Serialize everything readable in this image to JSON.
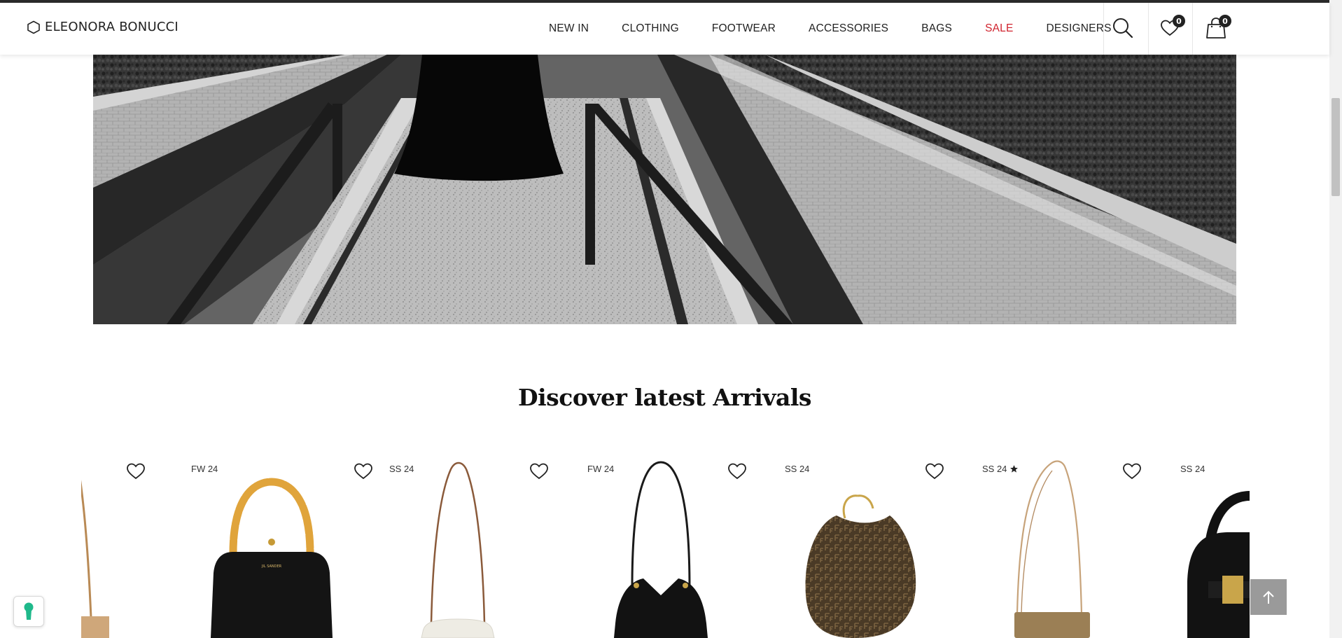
{
  "brand": {
    "name": "ELEONORA BONUCCI"
  },
  "nav": {
    "items": [
      {
        "label": "NEW IN"
      },
      {
        "label": "CLOTHING"
      },
      {
        "label": "FOOTWEAR"
      },
      {
        "label": "ACCESSORIES"
      },
      {
        "label": "BAGS"
      },
      {
        "label": "SALE"
      },
      {
        "label": "DESIGNERS"
      }
    ],
    "sale_color": "#d0232e"
  },
  "header_icons": {
    "search": "search-icon",
    "wishlist": {
      "icon": "heart-icon",
      "count": "0"
    },
    "cart": {
      "icon": "shopping-bag-icon",
      "count": "0"
    }
  },
  "hero": {
    "image": "black-and-white photo of a figure in a long black dress on a concrete walkway"
  },
  "section": {
    "title": "Discover latest Arrivals"
  },
  "products": [
    {
      "season": "",
      "image": "beige crossbody strap bag (partially visible)"
    },
    {
      "season": "FW 24",
      "image": "black leather handbag with bamboo handle"
    },
    {
      "season": "SS 24",
      "image": "white shoulder bag with long leather strap"
    },
    {
      "season": "FW 24",
      "image": "black leather hobo shoulder bag"
    },
    {
      "season": "SS 24",
      "image": "brown monogram croissant bag with gold chain"
    },
    {
      "season": "SS 24",
      "featured": true,
      "image": "tan crossbody bag with thin strap"
    },
    {
      "season": "SS 24",
      "image": "black top-handle bag with gold buckle (partially visible)"
    }
  ],
  "controls": {
    "back_to_top": "arrow-up-icon",
    "accessibility": "keyhole-icon"
  },
  "colors": {
    "text": "#111111",
    "header_bg": "#ffffff",
    "back_to_top_bg": "#9a9a9a",
    "accent": "#1fb98b"
  }
}
